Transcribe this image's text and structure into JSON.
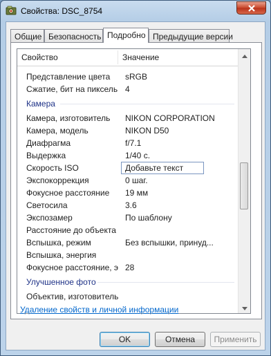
{
  "window": {
    "title": "Свойства: DSC_8754"
  },
  "tabs": [
    {
      "label": "Общие"
    },
    {
      "label": "Безопасность"
    },
    {
      "label": "Подробно"
    },
    {
      "label": "Предыдущие версии"
    }
  ],
  "list": {
    "columns": {
      "name": "Свойство",
      "value": "Значение"
    },
    "rows_top": [
      {
        "name": "Представление цвета",
        "value": "sRGB"
      },
      {
        "name": "Сжатие, бит на пиксель",
        "value": "4"
      }
    ],
    "group_camera": "Камера",
    "camera_rows": [
      {
        "name": "Камера, изготовитель",
        "value": "NIKON CORPORATION"
      },
      {
        "name": "Камера, модель",
        "value": "NIKON D50"
      },
      {
        "name": "Диафрагма",
        "value": "f/7.1"
      },
      {
        "name": "Выдержка",
        "value": "1/40 с."
      },
      {
        "name": "Скорость ISO",
        "value": ""
      },
      {
        "name": "Экспокоррекция",
        "value": "0 шаг."
      },
      {
        "name": "Фокусное расстояние",
        "value": "19 мм"
      },
      {
        "name": "Светосила",
        "value": "3.6"
      },
      {
        "name": "Экспозамер",
        "value": "По шаблону"
      },
      {
        "name": "Расстояние до объекта",
        "value": ""
      },
      {
        "name": "Вспышка, режим",
        "value": "Без вспышки, принуд..."
      },
      {
        "name": "Вспышка, энергия",
        "value": ""
      },
      {
        "name": "Фокусное расстояние, э...",
        "value": "28"
      }
    ],
    "iso_edit_value": "Добавьте текст",
    "group_enhanced": "Улучшенное фото",
    "partial_row": "Объектив, изготовитель"
  },
  "link": "Удаление свойств и личной информации",
  "buttons": {
    "ok": "OK",
    "cancel": "Отмена",
    "apply": "Применить"
  }
}
